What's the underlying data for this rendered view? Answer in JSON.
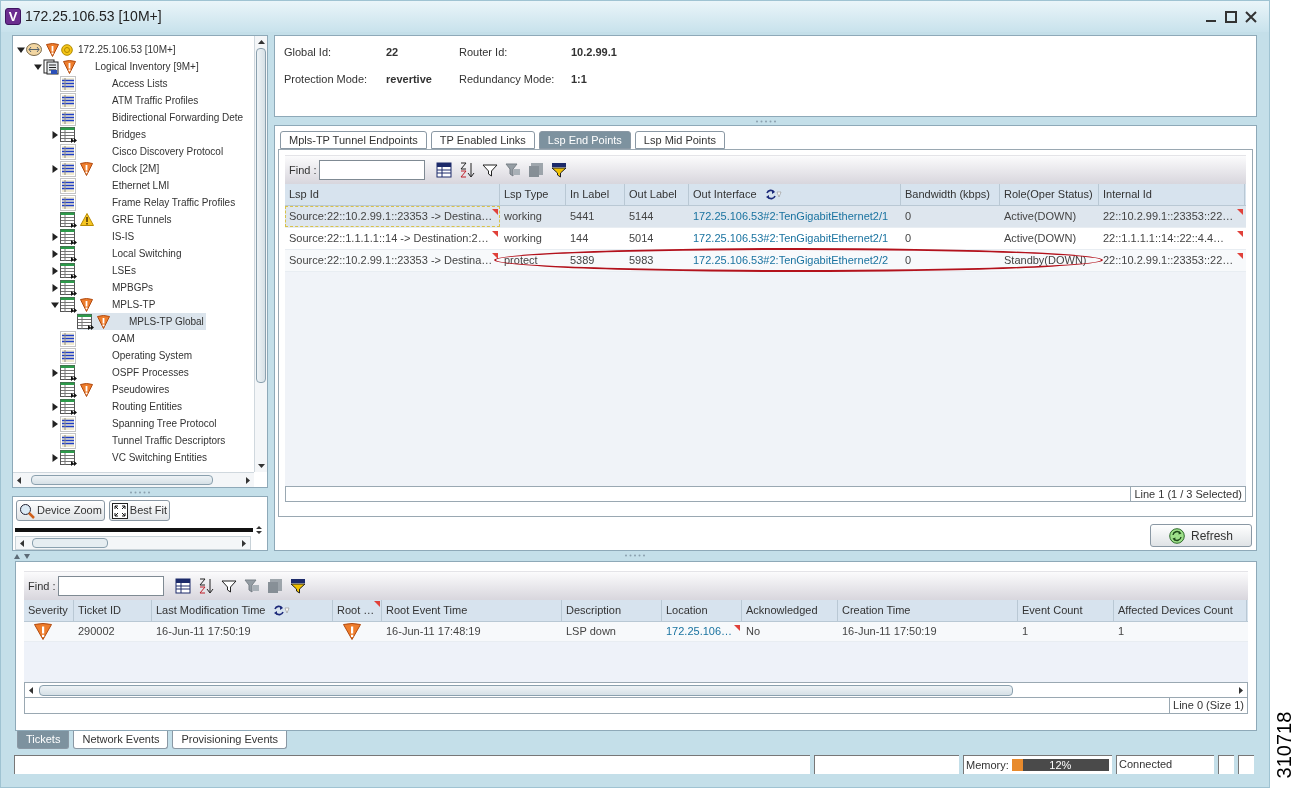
{
  "window": {
    "logo": "V",
    "title": "172.25.106.53 [10M+]"
  },
  "tree": {
    "items": [
      {
        "label": "172.25.106.53 [10M+]",
        "kind": "device",
        "major_alarm": true,
        "warning": false,
        "status": true,
        "has_children": true,
        "expanded": true,
        "selected": false,
        "children": [
          {
            "label": "Logical Inventory [9M+]",
            "kind": "inventory",
            "major_alarm": true,
            "warning": false,
            "status": false,
            "has_children": true,
            "expanded": true,
            "selected": false,
            "children": [
              {
                "label": "Access Lists",
                "kind": "list",
                "major_alarm": false,
                "warning": false,
                "status": false,
                "has_children": false,
                "selected": false
              },
              {
                "label": "ATM Traffic Profiles",
                "kind": "list",
                "major_alarm": false,
                "warning": false,
                "status": false,
                "has_children": false,
                "selected": false
              },
              {
                "label": "Bidirectional Forwarding Dete",
                "kind": "list",
                "major_alarm": false,
                "warning": false,
                "status": false,
                "has_children": false,
                "selected": false
              },
              {
                "label": "Bridges",
                "kind": "table",
                "major_alarm": false,
                "warning": false,
                "status": false,
                "has_children": true,
                "expanded": false,
                "selected": false
              },
              {
                "label": "Cisco Discovery Protocol",
                "kind": "list",
                "major_alarm": false,
                "warning": false,
                "status": false,
                "has_children": false,
                "selected": false
              },
              {
                "label": "Clock [2M]",
                "kind": "list",
                "major_alarm": true,
                "warning": false,
                "status": false,
                "has_children": true,
                "expanded": false,
                "selected": false
              },
              {
                "label": "Ethernet LMI",
                "kind": "list",
                "major_alarm": false,
                "warning": false,
                "status": false,
                "has_children": false,
                "selected": false
              },
              {
                "label": "Frame Relay Traffic Profiles",
                "kind": "list",
                "major_alarm": false,
                "warning": false,
                "status": false,
                "has_children": false,
                "selected": false
              },
              {
                "label": "GRE Tunnels",
                "kind": "table",
                "major_alarm": false,
                "warning": true,
                "status": false,
                "has_children": false,
                "selected": false
              },
              {
                "label": "IS-IS",
                "kind": "table",
                "major_alarm": false,
                "warning": false,
                "status": false,
                "has_children": true,
                "expanded": false,
                "selected": false
              },
              {
                "label": "Local Switching",
                "kind": "table",
                "major_alarm": false,
                "warning": false,
                "status": false,
                "has_children": true,
                "expanded": false,
                "selected": false
              },
              {
                "label": "LSEs",
                "kind": "table",
                "major_alarm": false,
                "warning": false,
                "status": false,
                "has_children": true,
                "expanded": false,
                "selected": false
              },
              {
                "label": "MPBGPs",
                "kind": "table",
                "major_alarm": false,
                "warning": false,
                "status": false,
                "has_children": true,
                "expanded": false,
                "selected": false
              },
              {
                "label": "MPLS-TP",
                "kind": "table",
                "major_alarm": true,
                "warning": false,
                "status": false,
                "has_children": true,
                "expanded": true,
                "selected": false,
                "children": [
                  {
                    "label": "MPLS-TP Global",
                    "kind": "table",
                    "major_alarm": true,
                    "warning": false,
                    "status": false,
                    "has_children": false,
                    "selected": true
                  }
                ]
              },
              {
                "label": "OAM",
                "kind": "list",
                "major_alarm": false,
                "warning": false,
                "status": false,
                "has_children": false,
                "selected": false
              },
              {
                "label": "Operating System",
                "kind": "list",
                "major_alarm": false,
                "warning": false,
                "status": false,
                "has_children": false,
                "selected": false
              },
              {
                "label": "OSPF Processes",
                "kind": "table",
                "major_alarm": false,
                "warning": false,
                "status": false,
                "has_children": true,
                "expanded": false,
                "selected": false
              },
              {
                "label": "Pseudowires",
                "kind": "table",
                "major_alarm": true,
                "warning": false,
                "status": false,
                "has_children": false,
                "selected": false
              },
              {
                "label": "Routing Entities",
                "kind": "table",
                "major_alarm": false,
                "warning": false,
                "status": false,
                "has_children": true,
                "expanded": false,
                "selected": false
              },
              {
                "label": "Spanning Tree Protocol",
                "kind": "list",
                "major_alarm": false,
                "warning": false,
                "status": false,
                "has_children": true,
                "expanded": false,
                "selected": false
              },
              {
                "label": "Tunnel Traffic Descriptors",
                "kind": "list",
                "major_alarm": false,
                "warning": false,
                "status": false,
                "has_children": false,
                "selected": false
              },
              {
                "label": "VC Switching Entities",
                "kind": "table",
                "major_alarm": false,
                "warning": false,
                "status": false,
                "has_children": true,
                "expanded": false,
                "selected": false
              }
            ]
          }
        ]
      }
    ]
  },
  "zoom_buttons": [
    "Device Zoom",
    "Best Fit"
  ],
  "properties": [
    {
      "label": "Global Id:",
      "value": "22"
    },
    {
      "label": "Router Id:",
      "value": "10.2.99.1"
    },
    {
      "label": "Protection Mode:",
      "value": "revertive"
    },
    {
      "label": "Redundancy Mode:",
      "value": "1:1"
    }
  ],
  "tabs": [
    {
      "label": "Mpls-TP Tunnel Endpoints",
      "selected": false
    },
    {
      "label": "TP Enabled Links",
      "selected": false
    },
    {
      "label": "Lsp End Points",
      "selected": true
    },
    {
      "label": "Lsp Mid Points",
      "selected": false
    }
  ],
  "endpoints": {
    "find_label": "Find :",
    "columns": [
      {
        "label": "Lsp Id",
        "sorted": false
      },
      {
        "label": "Lsp Type",
        "sorted": false
      },
      {
        "label": "In Label",
        "sorted": false
      },
      {
        "label": "Out Label",
        "sorted": false
      },
      {
        "label": "Out Interface",
        "sorted": true,
        "link": true
      },
      {
        "label": "Bandwidth (kbps)",
        "sorted": false
      },
      {
        "label": "Role(Oper Status)",
        "sorted": false
      },
      {
        "label": "Internal Id",
        "sorted": false
      }
    ],
    "rows": [
      {
        "selected": true,
        "circled": false,
        "cells": [
          {
            "text": "Source:22::10.2.99.1::23353 -> Destina…",
            "marked": true
          },
          "working",
          "5441",
          "5144",
          "172.25.106.53#2:TenGigabitEthernet2/1",
          "0",
          "Active(DOWN)",
          {
            "text": "22::10.2.99.1::23353::22…",
            "marked": true
          }
        ]
      },
      {
        "selected": false,
        "circled": false,
        "cells": [
          {
            "text": "Source:22::1.1.1.1::14 -> Destination:2…",
            "marked": true
          },
          "working",
          "144",
          "5014",
          "172.25.106.53#2:TenGigabitEthernet2/1",
          "0",
          "Active(DOWN)",
          {
            "text": "22::1.1.1.1::14::22::4.4…",
            "marked": true
          }
        ]
      },
      {
        "selected": false,
        "circled": true,
        "cells": [
          {
            "text": "Source:22::10.2.99.1::23353 -> Destina…",
            "marked": true
          },
          "protect",
          "5389",
          "5983",
          "172.25.106.53#2:TenGigabitEthernet2/2",
          "0",
          "Standby(DOWN)",
          {
            "text": "22::10.2.99.1::23353::22…",
            "marked": true
          }
        ]
      }
    ],
    "status": "Line 1 (1 / 3 Selected)"
  },
  "refresh_button": "Refresh",
  "tickets": {
    "find_label": "Find :",
    "columns": [
      {
        "label": "Severity",
        "sorted": false
      },
      {
        "label": "Ticket ID",
        "sorted": false
      },
      {
        "label": "Last Modification Time",
        "sorted": true
      },
      {
        "label": "Root …",
        "marked": true,
        "sorted": false
      },
      {
        "label": "Root Event Time",
        "sorted": false
      },
      {
        "label": "Description",
        "sorted": false
      },
      {
        "label": "Location",
        "sorted": false,
        "link": true
      },
      {
        "label": "Acknowledged",
        "sorted": false
      },
      {
        "label": "Creation Time",
        "sorted": false
      },
      {
        "label": "Event Count",
        "sorted": false
      },
      {
        "label": "Affected Devices Count",
        "sorted": false
      }
    ],
    "rows": [
      {
        "selected": false,
        "cells": [
          {
            "kind": "alarm"
          },
          "290002",
          "16-Jun-11 17:50:19",
          {
            "kind": "alarm"
          },
          "16-Jun-11 17:48:19",
          "LSP down",
          {
            "text": "172.25.106…",
            "marked": true
          },
          "No",
          "16-Jun-11 17:50:19",
          "1",
          "1"
        ]
      }
    ],
    "status": "Line 0 (Size 1)"
  },
  "bottom_tabs": [
    {
      "label": "Tickets",
      "selected": true
    },
    {
      "label": "Network Events",
      "selected": false
    },
    {
      "label": "Provisioning Events",
      "selected": false
    }
  ],
  "status_bar": {
    "memory_label": "Memory:",
    "memory": {
      "level": 0.12,
      "reading": "12%"
    },
    "connection": "Connected"
  },
  "figure_number": "310718"
}
